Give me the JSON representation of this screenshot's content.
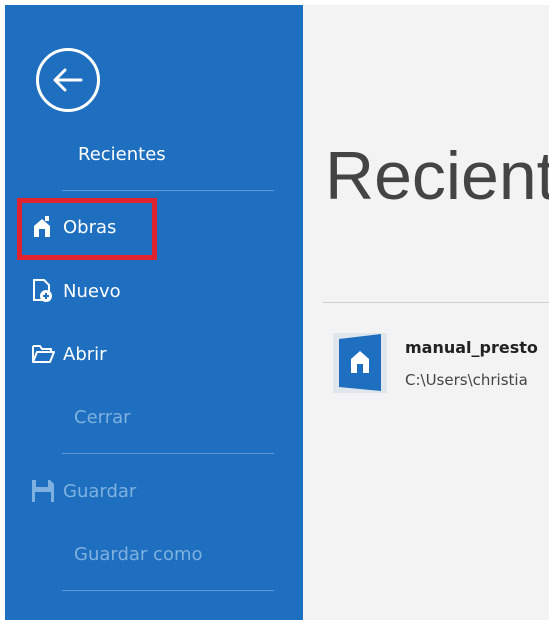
{
  "sidebar": {
    "back_icon": "back-arrow-icon",
    "items": [
      {
        "label": "Recientes",
        "icon": null,
        "enabled": true
      },
      {
        "label": "Obras",
        "icon": "works-icon",
        "enabled": true,
        "highlighted": true
      },
      {
        "label": "Nuevo",
        "icon": "new-file-icon",
        "enabled": true
      },
      {
        "label": "Abrir",
        "icon": "open-folder-icon",
        "enabled": true
      },
      {
        "label": "Cerrar",
        "icon": null,
        "enabled": false
      },
      {
        "label": "Guardar",
        "icon": "save-icon",
        "enabled": false
      },
      {
        "label": "Guardar como",
        "icon": null,
        "enabled": false
      }
    ]
  },
  "main": {
    "title": "Recientes",
    "recent_files": [
      {
        "name": "manual_presto",
        "path": "C:\\Users\\christia",
        "icon": "presto-file-icon"
      }
    ]
  },
  "colors": {
    "sidebar_bg": "#1e6fbf",
    "highlight": "#e0232e",
    "content_bg": "#f3f3f3"
  }
}
